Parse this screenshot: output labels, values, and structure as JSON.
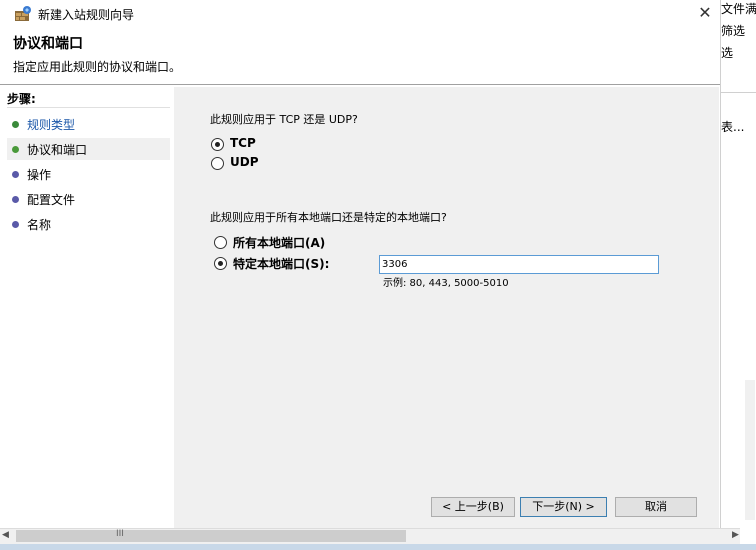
{
  "window": {
    "title": "新建入站规则向导",
    "close_symbol": "✕"
  },
  "header": {
    "title": "协议和端口",
    "subtitle": "指定应用此规则的协议和端口。"
  },
  "background_window": {
    "lines": [
      "文件满",
      "筛选",
      "选",
      "表..."
    ]
  },
  "steps": {
    "title": "步骤:",
    "items": [
      {
        "label": "规则类型",
        "color": "#3a8a3a",
        "link_color": "#1a56a8"
      },
      {
        "label": "协议和端口",
        "color": "#4a9a3a",
        "link_color": "#000000"
      },
      {
        "label": "操作",
        "color": "#5a5aa8",
        "link_color": "#000000"
      },
      {
        "label": "配置文件",
        "color": "#5a5aa8",
        "link_color": "#000000"
      },
      {
        "label": "名称",
        "color": "#5a5aa8",
        "link_color": "#000000"
      }
    ]
  },
  "protocol": {
    "question": "此规则应用于 TCP 还是 UDP?",
    "options": [
      {
        "label": "TCP",
        "selected": true
      },
      {
        "label": "UDP",
        "selected": false
      }
    ]
  },
  "ports": {
    "question": "此规则应用于所有本地端口还是特定的本地端口?",
    "options": [
      {
        "label": "所有本地端口(A)",
        "selected": false
      },
      {
        "label": "特定本地端口(S):",
        "selected": true
      }
    ],
    "value": "3306",
    "example": "示例: 80, 443, 5000-5010"
  },
  "buttons": {
    "back": "< 上一步(B)",
    "next": "下一步(N) >",
    "cancel": "取消"
  },
  "scrollbar": {
    "left_arrow": "◀",
    "right_arrow": "▶",
    "grip": "III"
  }
}
